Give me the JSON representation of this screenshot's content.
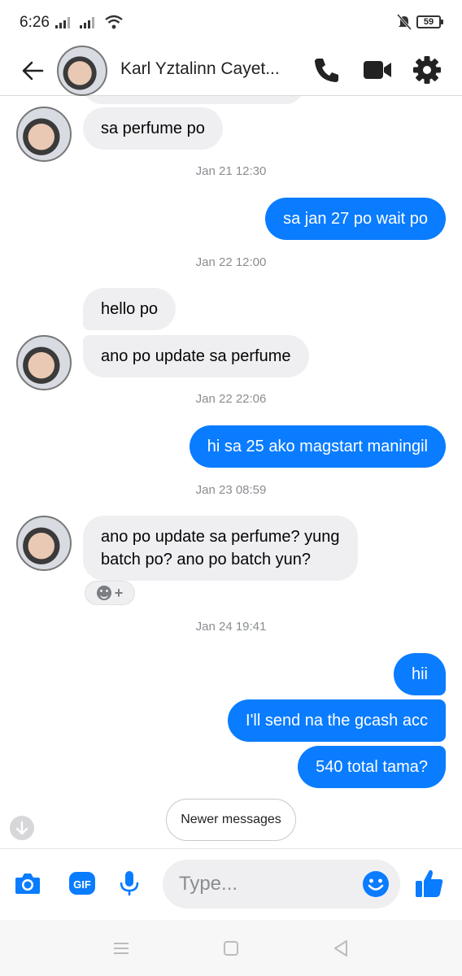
{
  "status_bar": {
    "time": "6:26",
    "battery": "59"
  },
  "header": {
    "contact_name": "Karl Yztalinn Cayet..."
  },
  "conversation": {
    "partial_top": "",
    "messages": [
      {
        "type": "in",
        "text": "sa perfume po"
      },
      {
        "type": "time",
        "text": "Jan 21 12:30"
      },
      {
        "type": "out",
        "text": "sa jan 27 po wait po"
      },
      {
        "type": "time",
        "text": "Jan 22 12:00"
      },
      {
        "type": "in",
        "text": "hello po"
      },
      {
        "type": "in",
        "text": "ano po update sa perfume"
      },
      {
        "type": "time",
        "text": "Jan 22 22:06"
      },
      {
        "type": "out",
        "text": "hi sa 25 ako magstart maningil"
      },
      {
        "type": "time",
        "text": "Jan 23 08:59"
      },
      {
        "type": "in",
        "line1": "ano po update sa perfume? yung",
        "line2": "batch po? ano po batch yun?"
      },
      {
        "type": "time",
        "text": "Jan 24 19:41"
      },
      {
        "type": "out",
        "text": "hii"
      },
      {
        "type": "out",
        "text": "I'll send na the gcash acc"
      },
      {
        "type": "out",
        "text": "540 total tama?"
      }
    ],
    "newer_messages_label": "Newer messages"
  },
  "composer": {
    "placeholder": "Type...",
    "icons": [
      "camera-icon",
      "gif-icon",
      "microphone-icon",
      "emoji-icon",
      "like-icon"
    ]
  },
  "colors": {
    "accent": "#0a7cff",
    "incoming_bubble": "#efeff1",
    "outgoing_bubble": "#0a7cff",
    "timestamp": "#8a8d91"
  }
}
